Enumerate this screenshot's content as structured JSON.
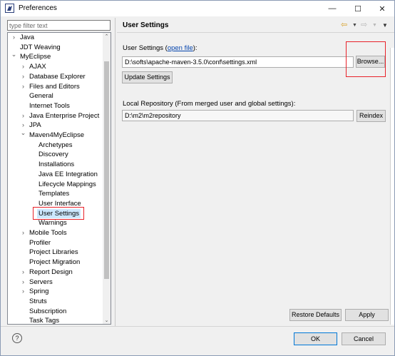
{
  "window": {
    "title": "Preferences",
    "minimize": "—",
    "maximize": "☐",
    "close": "✕"
  },
  "sidebar": {
    "filter_placeholder": "type filter text",
    "items": [
      {
        "label": "Java",
        "arrow": "›"
      },
      {
        "label": "JDT Weaving",
        "arrow": ""
      },
      {
        "label": "MyEclipse",
        "arrow": "⌄"
      },
      {
        "label": "AJAX",
        "arrow": "›"
      },
      {
        "label": "Database Explorer",
        "arrow": "›"
      },
      {
        "label": "Files and Editors",
        "arrow": "›"
      },
      {
        "label": "General",
        "arrow": ""
      },
      {
        "label": "Internet Tools",
        "arrow": ""
      },
      {
        "label": "Java Enterprise Project",
        "arrow": "›"
      },
      {
        "label": "JPA",
        "arrow": "›"
      },
      {
        "label": "Maven4MyEclipse",
        "arrow": "⌄"
      },
      {
        "label": "Archetypes",
        "arrow": ""
      },
      {
        "label": "Discovery",
        "arrow": ""
      },
      {
        "label": "Installations",
        "arrow": ""
      },
      {
        "label": "Java EE Integration",
        "arrow": ""
      },
      {
        "label": "Lifecycle Mappings",
        "arrow": ""
      },
      {
        "label": "Templates",
        "arrow": ""
      },
      {
        "label": "User Interface",
        "arrow": ""
      },
      {
        "label": "User Settings",
        "arrow": ""
      },
      {
        "label": "Warnings",
        "arrow": ""
      },
      {
        "label": "Mobile Tools",
        "arrow": "›"
      },
      {
        "label": "Profiler",
        "arrow": ""
      },
      {
        "label": "Project Libraries",
        "arrow": ""
      },
      {
        "label": "Project Migration",
        "arrow": ""
      },
      {
        "label": "Report Design",
        "arrow": "›"
      },
      {
        "label": "Servers",
        "arrow": "›"
      },
      {
        "label": "Spring",
        "arrow": "›"
      },
      {
        "label": "Struts",
        "arrow": ""
      },
      {
        "label": "Subscription",
        "arrow": ""
      },
      {
        "label": "Task Tags",
        "arrow": ""
      }
    ],
    "selected": "User Settings"
  },
  "page": {
    "title": "User Settings",
    "user_settings_label": "User Settings (",
    "user_settings_link": "open file",
    "user_settings_suffix": "):",
    "settings_path": "D:\\softs\\apache-maven-3.5.0\\conf\\settings.xml",
    "browse_label": "Browse...",
    "update_label": "Update Settings",
    "local_repo_label": "Local Repository (From merged user and global settings):",
    "local_repo_path": "D:\\m2\\m2repository",
    "reindex_label": "Reindex",
    "restore_label": "Restore Defaults",
    "apply_label": "Apply"
  },
  "footer": {
    "help": "?",
    "ok_label": "OK",
    "cancel_label": "Cancel"
  },
  "colors": {
    "highlight": "#e8222a",
    "selection": "#cce8ff",
    "link": "#0645ad",
    "primary_border": "#0078d7"
  }
}
